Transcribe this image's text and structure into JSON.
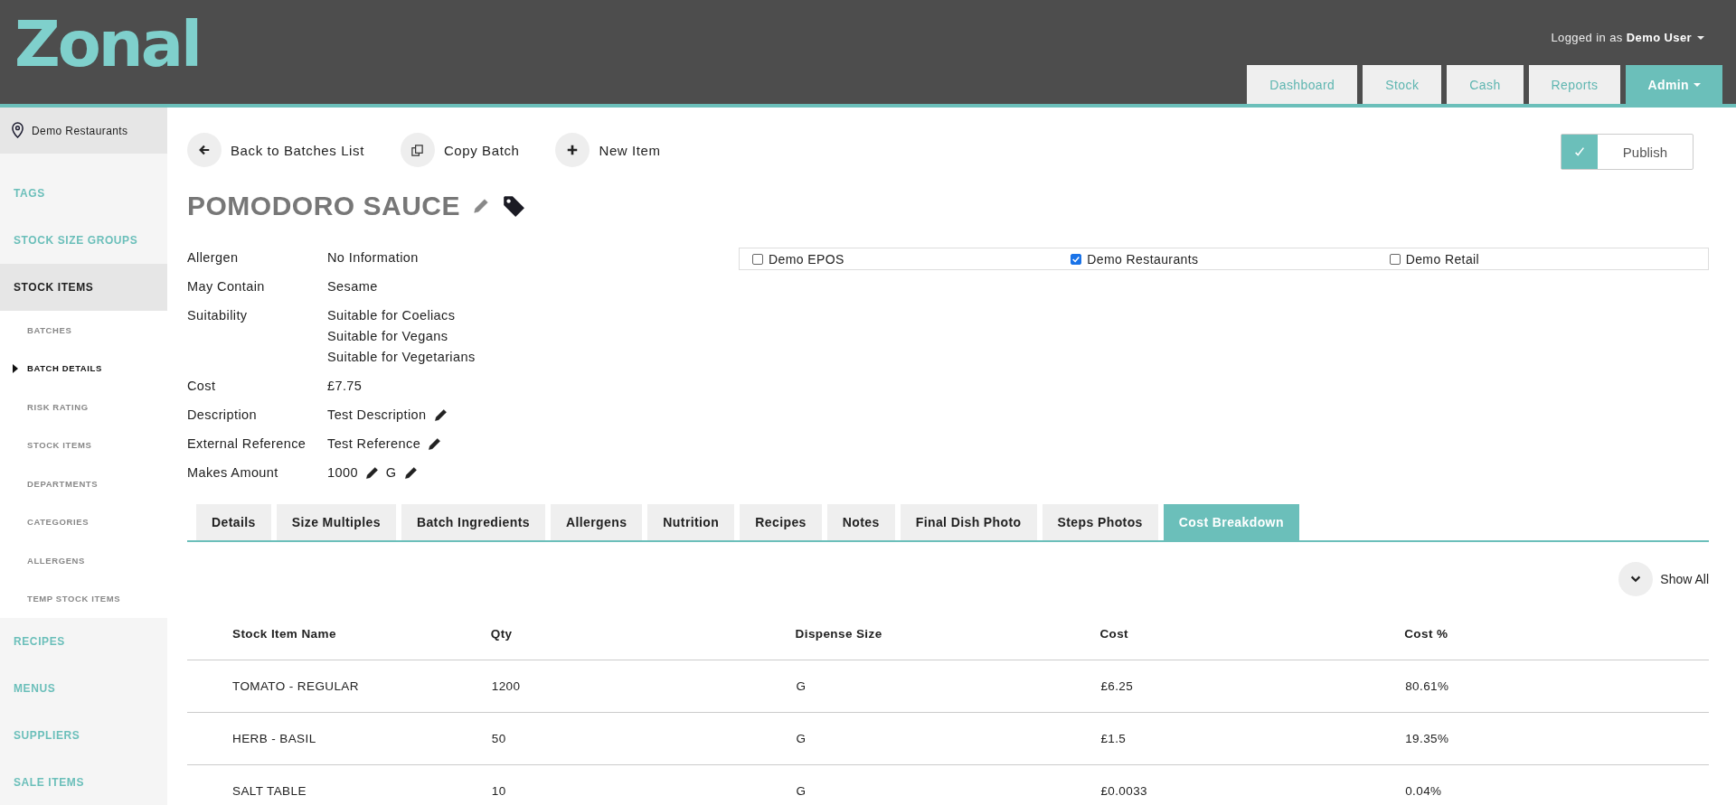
{
  "header": {
    "logo": "Zonal",
    "user_prefix": "Logged in as",
    "user_name": "Demo User",
    "nav": [
      {
        "label": "Dashboard",
        "selected": false,
        "dropdown": false
      },
      {
        "label": "Stock",
        "selected": false,
        "dropdown": false
      },
      {
        "label": "Cash",
        "selected": false,
        "dropdown": false
      },
      {
        "label": "Reports",
        "selected": false,
        "dropdown": false
      },
      {
        "label": "Admin",
        "selected": true,
        "dropdown": true
      }
    ]
  },
  "sidebar": {
    "location": "Demo Restaurants",
    "items": [
      {
        "label": "TAGS",
        "selected": false
      },
      {
        "label": "STOCK SIZE GROUPS",
        "selected": false
      },
      {
        "label": "STOCK ITEMS",
        "selected": true,
        "children": [
          {
            "label": "BATCHES",
            "selected": false
          },
          {
            "label": "BATCH DETAILS",
            "selected": true
          },
          {
            "label": "RISK RATING",
            "selected": false
          },
          {
            "label": "STOCK ITEMS",
            "selected": false
          },
          {
            "label": "DEPARTMENTS",
            "selected": false
          },
          {
            "label": "CATEGORIES",
            "selected": false
          },
          {
            "label": "ALLERGENS",
            "selected": false
          },
          {
            "label": "TEMP STOCK ITEMS",
            "selected": false
          }
        ]
      },
      {
        "label": "RECIPES",
        "selected": false
      },
      {
        "label": "MENUS",
        "selected": false
      },
      {
        "label": "SUPPLIERS",
        "selected": false
      },
      {
        "label": "SALE ITEMS",
        "selected": false
      }
    ]
  },
  "actions": [
    {
      "kind": "back",
      "label": "Back to Batches List"
    },
    {
      "kind": "copy",
      "label": "Copy Batch"
    },
    {
      "kind": "new",
      "label": "New Item"
    }
  ],
  "publish": {
    "label": "Publish",
    "checked": true
  },
  "title": "POMODORO SAUCE",
  "details": [
    {
      "label": "Allergen",
      "values": [
        "No Information"
      ],
      "editable": false
    },
    {
      "label": "May Contain",
      "values": [
        "Sesame"
      ],
      "editable": false
    },
    {
      "label": "Suitability",
      "values": [
        "Suitable for Coeliacs",
        "Suitable for Vegans",
        "Suitable for Vegetarians"
      ],
      "editable": false
    },
    {
      "label": "Cost",
      "values": [
        "£7.75"
      ],
      "editable": false
    },
    {
      "label": "Description",
      "values": [
        "Test Description"
      ],
      "editable": true
    },
    {
      "label": "External Reference",
      "values": [
        "Test Reference"
      ],
      "editable": true
    },
    {
      "label": "Makes Amount",
      "values": [
        "1000",
        "G"
      ],
      "editable": true
    }
  ],
  "sites": [
    {
      "label": "Demo EPOS",
      "checked": false
    },
    {
      "label": "Demo Restaurants",
      "checked": true
    },
    {
      "label": "Demo Retail",
      "checked": false
    }
  ],
  "tabs": [
    {
      "label": "Details",
      "selected": false
    },
    {
      "label": "Size Multiples",
      "selected": false
    },
    {
      "label": "Batch Ingredients",
      "selected": false
    },
    {
      "label": "Allergens",
      "selected": false
    },
    {
      "label": "Nutrition",
      "selected": false
    },
    {
      "label": "Recipes",
      "selected": false
    },
    {
      "label": "Notes",
      "selected": false
    },
    {
      "label": "Final Dish Photo",
      "selected": false
    },
    {
      "label": "Steps Photos",
      "selected": false
    },
    {
      "label": "Cost Breakdown",
      "selected": true
    }
  ],
  "show_all": "Show All",
  "table": {
    "columns": [
      "Stock Item Name",
      "Qty",
      "Dispense Size",
      "Cost",
      "Cost %"
    ],
    "rows": [
      [
        "TOMATO - REGULAR",
        "1200",
        "G",
        "£6.25",
        "80.61%"
      ],
      [
        "HERB - BASIL",
        "50",
        "G",
        "£1.5",
        "19.35%"
      ],
      [
        "SALT TABLE",
        "10",
        "G",
        "£0.0033",
        "0.04%"
      ]
    ]
  }
}
